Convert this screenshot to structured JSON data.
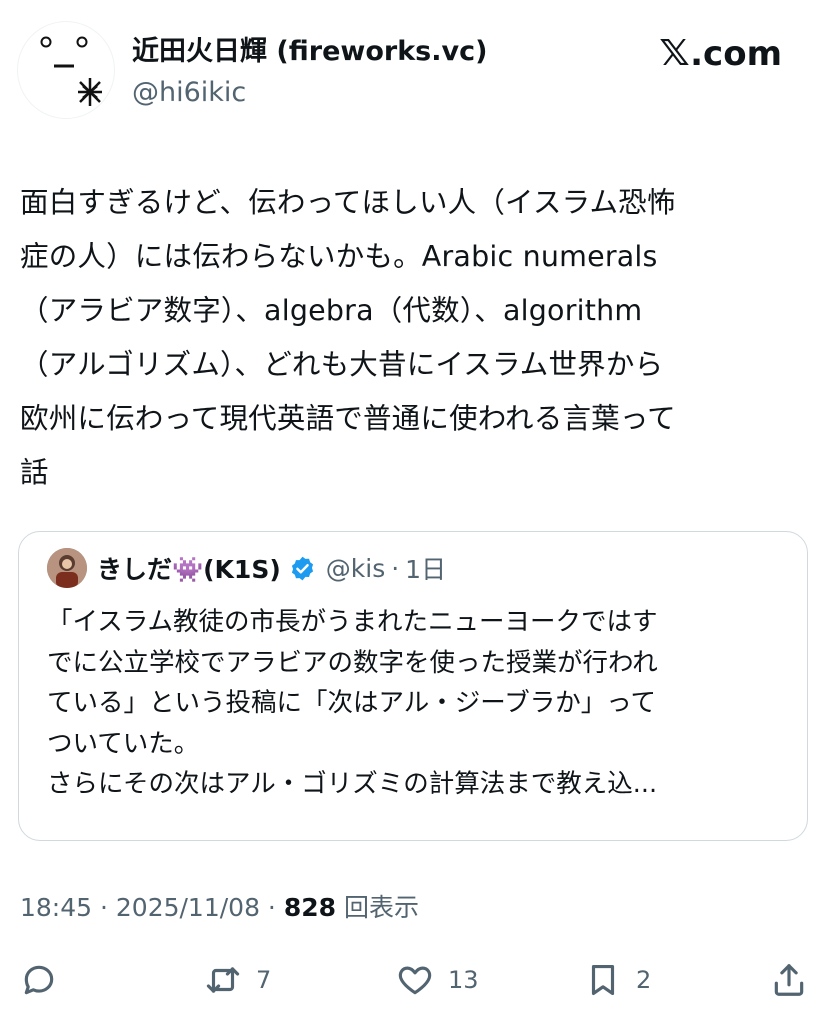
{
  "author": {
    "display_name": "近田火日輝 (fireworks.vc)",
    "handle": "@hi6ikic"
  },
  "brand": {
    "label": ".com",
    "icon": "x-logo-icon"
  },
  "tweet": {
    "text": "面白すぎるけど、伝わってほしい人（イスラム恐怖\n症の人）には伝わらないかも。Arabic numerals\n（アラビア数字）、algebra（代数）、algorithm\n（アルゴリズム）、どれも大昔にイスラム世界から\n欧州に伝わって現代英語で普通に使われる言葉って\n話"
  },
  "quote": {
    "name": "きしだ👾(K1S)",
    "handle": "@kis",
    "separator": "·",
    "time": "1日",
    "text": "「イスラム教徒の市長がうまれたニューヨークではす\nでに公立学校でアラビアの数字を使った授業が行われ\nている」という投稿に「次はアル・ジーブラか」って\nついていた。\nさらにその次はアル・ゴリズミの計算法まで教え込..."
  },
  "meta": {
    "time": "18:45",
    "sep1": " · ",
    "date": "2025/11/08",
    "sep2": " · ",
    "views": "828",
    "views_label": " 回表示"
  },
  "actions": {
    "reply": {
      "count": ""
    },
    "retweet": {
      "count": "7"
    },
    "like": {
      "count": "13"
    },
    "bookmark": {
      "count": "2"
    }
  },
  "colors": {
    "text": "#0f1419",
    "secondary": "#536471",
    "border": "#cfd9de",
    "verified": "#1d9bf0"
  }
}
